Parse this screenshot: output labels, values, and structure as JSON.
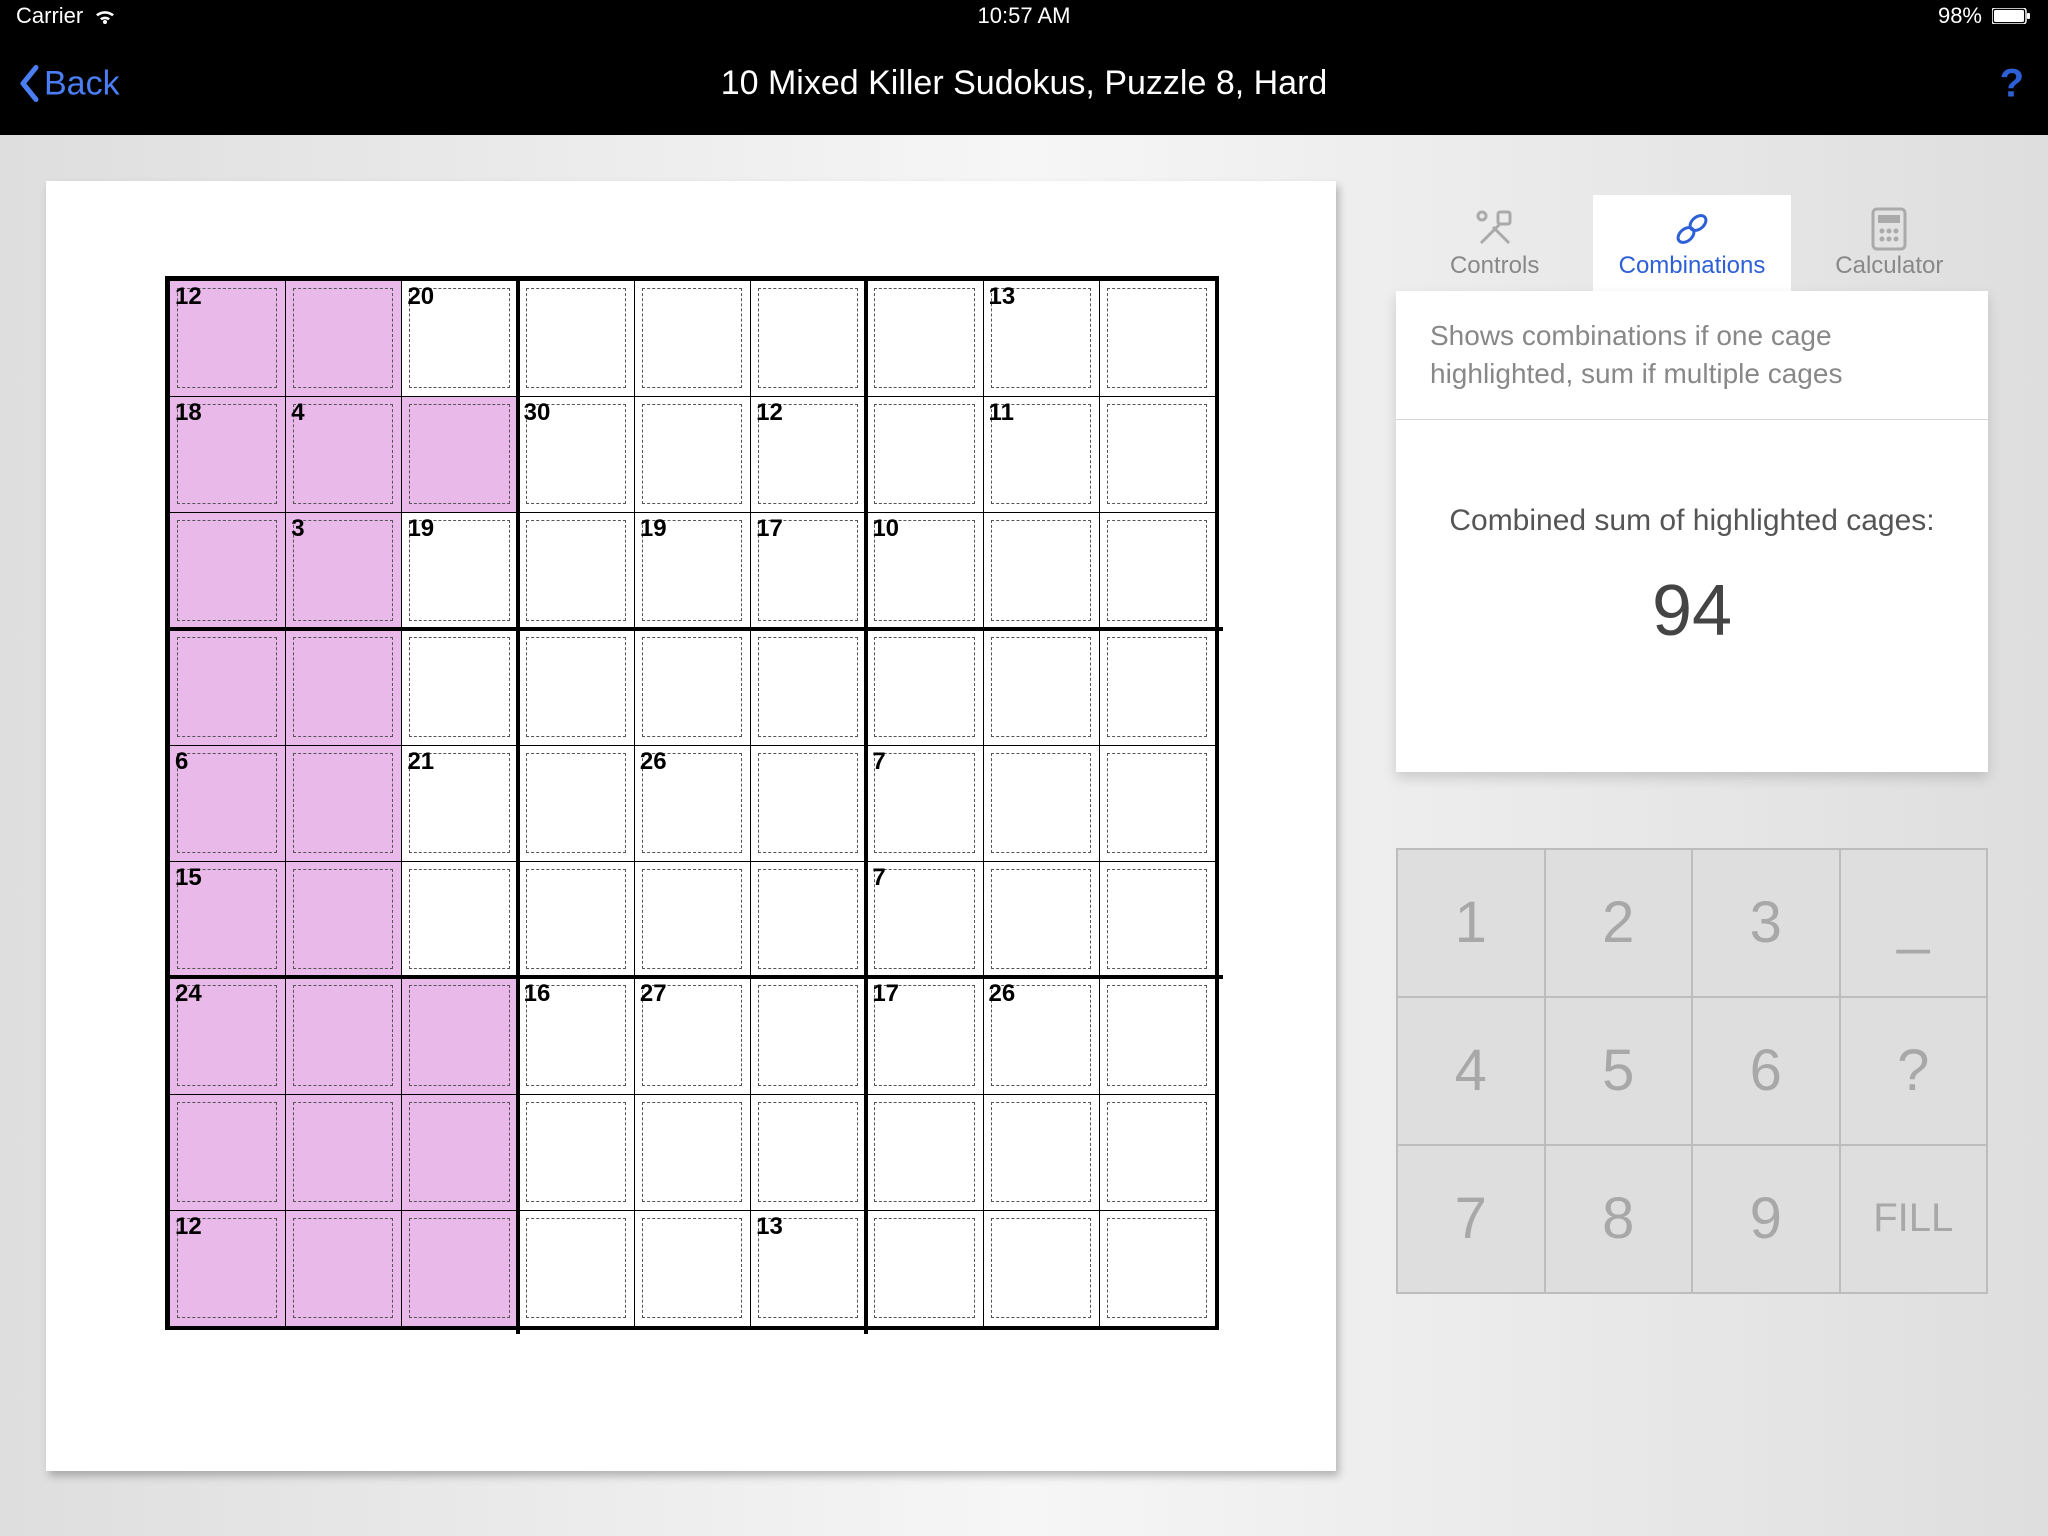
{
  "status": {
    "carrier": "Carrier",
    "time": "10:57 AM",
    "battery": "98%"
  },
  "nav": {
    "back": "Back",
    "title": "10 Mixed Killer Sudokus, Puzzle 8, Hard",
    "help": "?"
  },
  "sidebar": {
    "tabs": [
      "Controls",
      "Combinations",
      "Calculator"
    ],
    "activeTab": 1,
    "hint": "Shows combinations if one cage highlighted, sum if multiple cages",
    "sumLabel": "Combined sum of highlighted cages:",
    "sum": "94"
  },
  "keypad": [
    "1",
    "2",
    "3",
    "_",
    "4",
    "5",
    "6",
    "?",
    "7",
    "8",
    "9",
    "FILL"
  ],
  "cages": [
    {
      "r": 0,
      "c": 0,
      "v": "12"
    },
    {
      "r": 0,
      "c": 2,
      "v": "20"
    },
    {
      "r": 0,
      "c": 7,
      "v": "13"
    },
    {
      "r": 1,
      "c": 0,
      "v": "18"
    },
    {
      "r": 1,
      "c": 1,
      "v": "4"
    },
    {
      "r": 1,
      "c": 3,
      "v": "30"
    },
    {
      "r": 1,
      "c": 5,
      "v": "12"
    },
    {
      "r": 1,
      "c": 7,
      "v": "11"
    },
    {
      "r": 2,
      "c": 1,
      "v": "3"
    },
    {
      "r": 2,
      "c": 2,
      "v": "19"
    },
    {
      "r": 2,
      "c": 4,
      "v": "19"
    },
    {
      "r": 2,
      "c": 5,
      "v": "17"
    },
    {
      "r": 2,
      "c": 6,
      "v": "10"
    },
    {
      "r": 4,
      "c": 0,
      "v": "6"
    },
    {
      "r": 4,
      "c": 2,
      "v": "21"
    },
    {
      "r": 4,
      "c": 4,
      "v": "26"
    },
    {
      "r": 4,
      "c": 6,
      "v": "7"
    },
    {
      "r": 5,
      "c": 0,
      "v": "15"
    },
    {
      "r": 5,
      "c": 6,
      "v": "7"
    },
    {
      "r": 6,
      "c": 0,
      "v": "24"
    },
    {
      "r": 6,
      "c": 3,
      "v": "16"
    },
    {
      "r": 6,
      "c": 4,
      "v": "27"
    },
    {
      "r": 6,
      "c": 6,
      "v": "17"
    },
    {
      "r": 6,
      "c": 7,
      "v": "26"
    },
    {
      "r": 8,
      "c": 0,
      "v": "12"
    },
    {
      "r": 8,
      "c": 5,
      "v": "13"
    }
  ],
  "highlighted": [
    [
      0,
      0
    ],
    [
      0,
      1
    ],
    [
      1,
      0
    ],
    [
      1,
      1
    ],
    [
      1,
      2
    ],
    [
      2,
      0
    ],
    [
      2,
      1
    ],
    [
      3,
      0
    ],
    [
      3,
      1
    ],
    [
      4,
      0
    ],
    [
      4,
      1
    ],
    [
      5,
      0
    ],
    [
      5,
      1
    ],
    [
      6,
      0
    ],
    [
      6,
      1
    ],
    [
      6,
      2
    ],
    [
      7,
      0
    ],
    [
      7,
      1
    ],
    [
      7,
      2
    ],
    [
      8,
      0
    ],
    [
      8,
      1
    ],
    [
      8,
      2
    ]
  ]
}
